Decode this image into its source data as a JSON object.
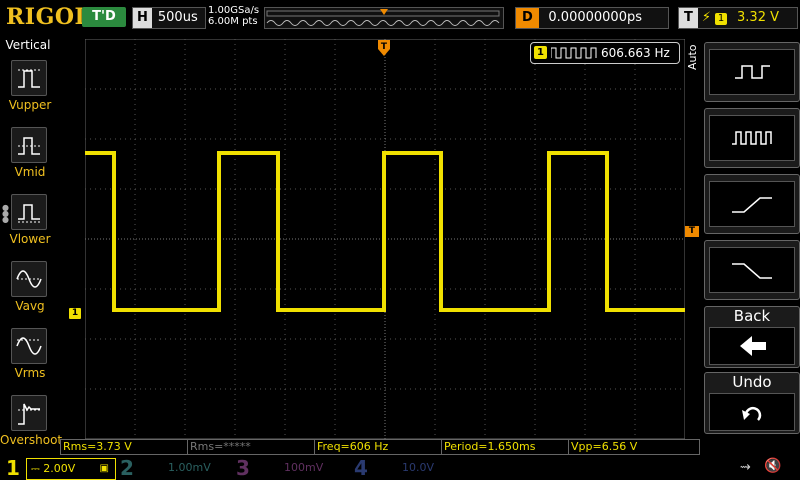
{
  "header": {
    "logo": "RIGOL",
    "run_status": "T'D",
    "timebase": {
      "key": "H",
      "value": "500us"
    },
    "sample_rate": "1.00GSa/s",
    "memory_depth": "6.00M pts",
    "delay": {
      "key": "D",
      "value": "0.00000000ps"
    },
    "trigger": {
      "key": "T",
      "source": "1",
      "level": "3.32 V"
    }
  },
  "left_menu": {
    "title": "Vertical",
    "items": [
      {
        "label": "Vupper",
        "icon": "vupper-icon"
      },
      {
        "label": "Vmid",
        "icon": "vmid-icon"
      },
      {
        "label": "Vlower",
        "icon": "vlower-icon"
      },
      {
        "label": "Vavg",
        "icon": "vavg-icon"
      },
      {
        "label": "Vrms",
        "icon": "vrms-icon"
      },
      {
        "label": "Overshoot",
        "icon": "overshoot-icon"
      }
    ]
  },
  "freq_counter": {
    "channel": "1",
    "value": "606.663 Hz"
  },
  "channel1_marker": "1",
  "trigger_marker": "T",
  "right_menu": {
    "auto_label": "Auto",
    "items": [
      {
        "name": "period-button",
        "icon": "period-icon"
      },
      {
        "name": "frequency-button",
        "icon": "frequency-icon"
      },
      {
        "name": "rise-time-button",
        "icon": "rise-time-icon"
      },
      {
        "name": "fall-time-button",
        "icon": "fall-time-icon"
      }
    ],
    "back_label": "Back",
    "undo_label": "Undo"
  },
  "measurements": [
    "Rms=3.73 V",
    "Rms=*****",
    "Freq=606 Hz",
    "Period=1.650ms",
    "Vpp=6.56 V"
  ],
  "channels": [
    {
      "num": "1",
      "scale": "2.00V",
      "color": "#f0e000"
    },
    {
      "num": "2",
      "scale": "1.00mV",
      "color": "#00b4b4"
    },
    {
      "num": "3",
      "scale": "100mV",
      "color": "#c040c0"
    },
    {
      "num": "4",
      "scale": "10.0V",
      "color": "#2060e0"
    }
  ],
  "colors": {
    "ch1": "#f0e000",
    "orange": "#f08a00",
    "logo": "#f0c020"
  }
}
